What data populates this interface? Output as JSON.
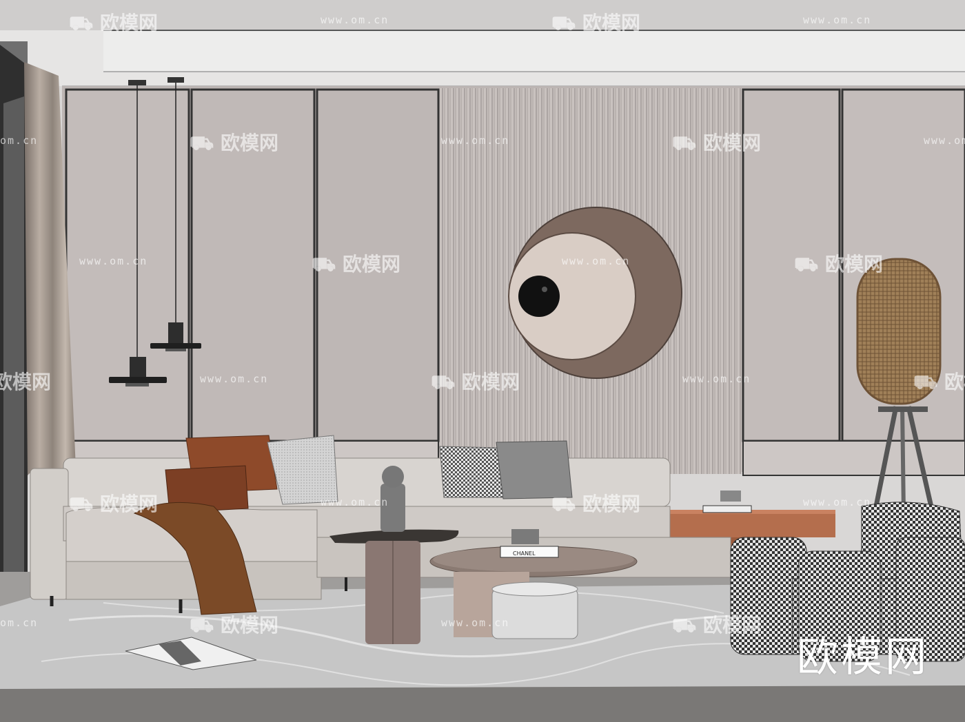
{
  "watermark": {
    "brand": "欧模网",
    "url": "www.om.cn",
    "url_short": "om.cn",
    "corner_mark": "欧模网"
  },
  "book_label": "CHANEL",
  "colors": {
    "wall": "#bdb6b4",
    "ceiling": "#e9e8e7",
    "floor": "#9a9896",
    "rug": "#bfbfbf",
    "sofa": "#d6d2ce",
    "leather": "#8a4a2b",
    "wall_art_outer": "#7e6a61",
    "wall_art_inner": "#d9cfc8",
    "rattan": "#9a7a52"
  },
  "icons": [
    "sofa-icon"
  ]
}
